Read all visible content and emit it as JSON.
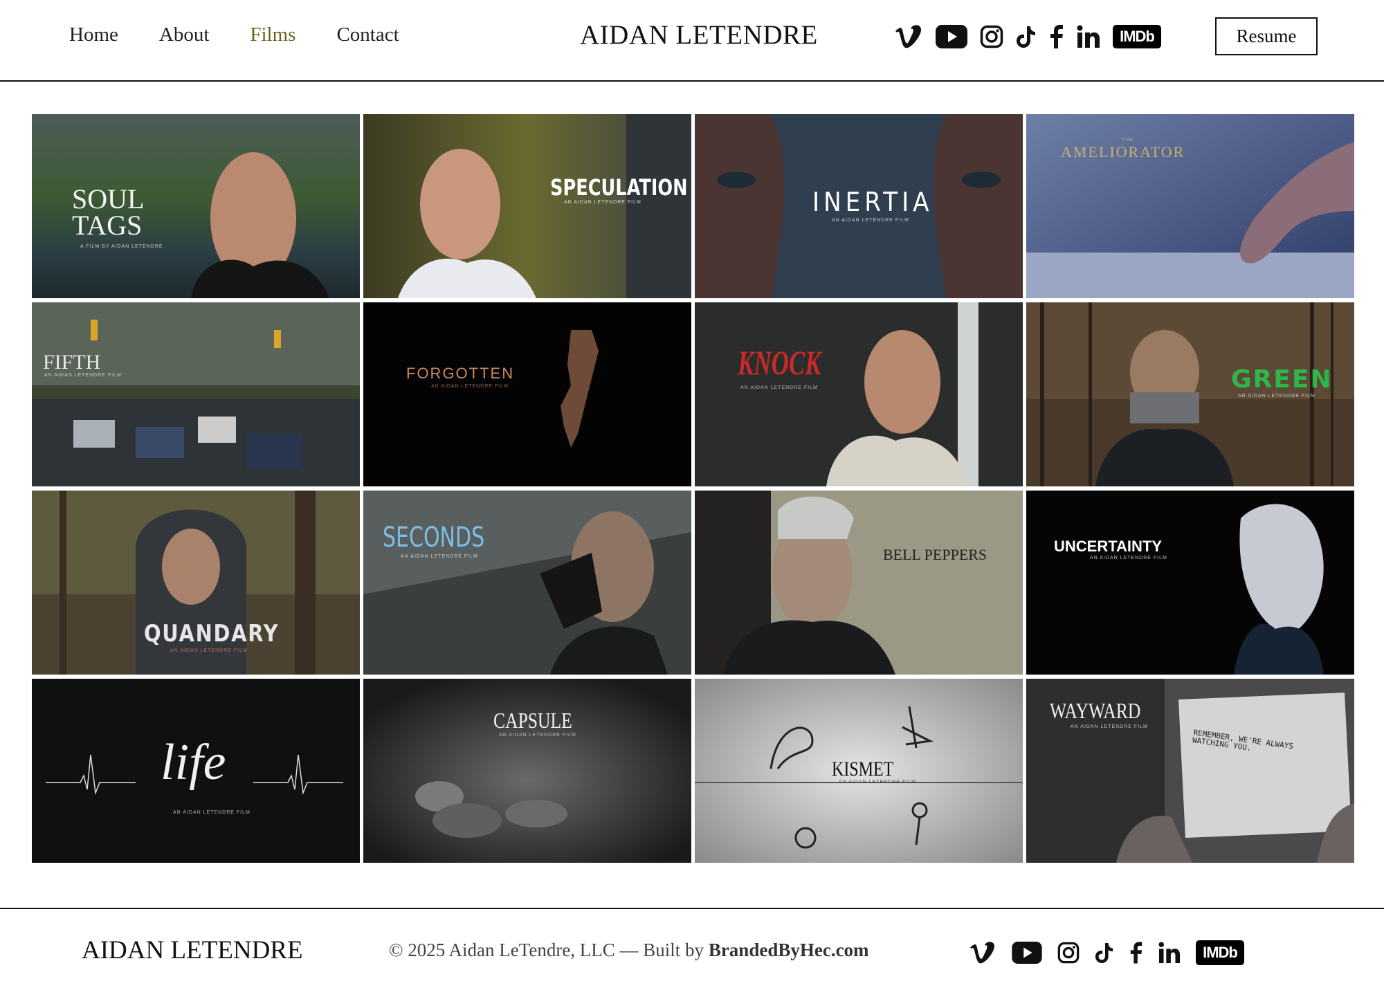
{
  "nav": {
    "items": [
      {
        "label": "Home",
        "active": false
      },
      {
        "label": "About",
        "active": false
      },
      {
        "label": "Films",
        "active": true
      },
      {
        "label": "Contact",
        "active": false
      }
    ],
    "active_color": "#6d6320"
  },
  "site_title": "AIDAN LETENDRE",
  "socials": [
    "vimeo-icon",
    "youtube-icon",
    "instagram-icon",
    "tiktok-icon",
    "facebook-icon",
    "linkedin-icon",
    "imdb-icon"
  ],
  "imdb_label": "IMDb",
  "resume_label": "Resume",
  "films": [
    {
      "title": "SOUL TAGS",
      "title_line1": "SOUL",
      "title_line2": "TAGS",
      "credit": "A FILM BY AIDAN LETENDRE"
    },
    {
      "title": "SPECULATION",
      "credit": "AN AIDAN LETENDRE FILM"
    },
    {
      "title": "INERTIA",
      "credit": "AN AIDAN LETENDRE FILM"
    },
    {
      "title": "AMELIORATOR",
      "prefix": "THE",
      "credit": ""
    },
    {
      "title": "FIFTH",
      "credit": "AN AIDAN LETENDRE FILM"
    },
    {
      "title": "FORGOTTEN",
      "credit": "AN AIDAN LETENDRE FILM"
    },
    {
      "title": "KNOCK",
      "credit": "AN AIDAN LETENDRE FILM"
    },
    {
      "title": "GREEN",
      "credit": "AN AIDAN LETENDRE FILM"
    },
    {
      "title": "QUANDARY",
      "credit": "AN AIDAN LETENDRE FILM"
    },
    {
      "title": "SECONDS",
      "credit": "AN AIDAN LETENDRE FILM"
    },
    {
      "title": "BELL PEPPERS",
      "credit": ""
    },
    {
      "title": "UNCERTAINTY",
      "credit": "AN AIDAN LETENDRE FILM"
    },
    {
      "title": "life",
      "credit": "AN AIDAN LETENDRE FILM"
    },
    {
      "title": "CAPSULE",
      "credit": "AN AIDAN LETENDRE FILM"
    },
    {
      "title": "KISMET",
      "credit": "AN AIDAN LETENDRE FILM"
    },
    {
      "title": "WAYWARD",
      "credit": "AN AIDAN LETENDRE FILM",
      "note": "REMEMBER, WE'RE ALWAYS WATCHING YOU."
    }
  ],
  "footer": {
    "title": "AIDAN LETENDRE",
    "copyright": "© 2025 Aidan LeTendre, LLC — Built by ",
    "builder": "BrandedByHec.com"
  }
}
